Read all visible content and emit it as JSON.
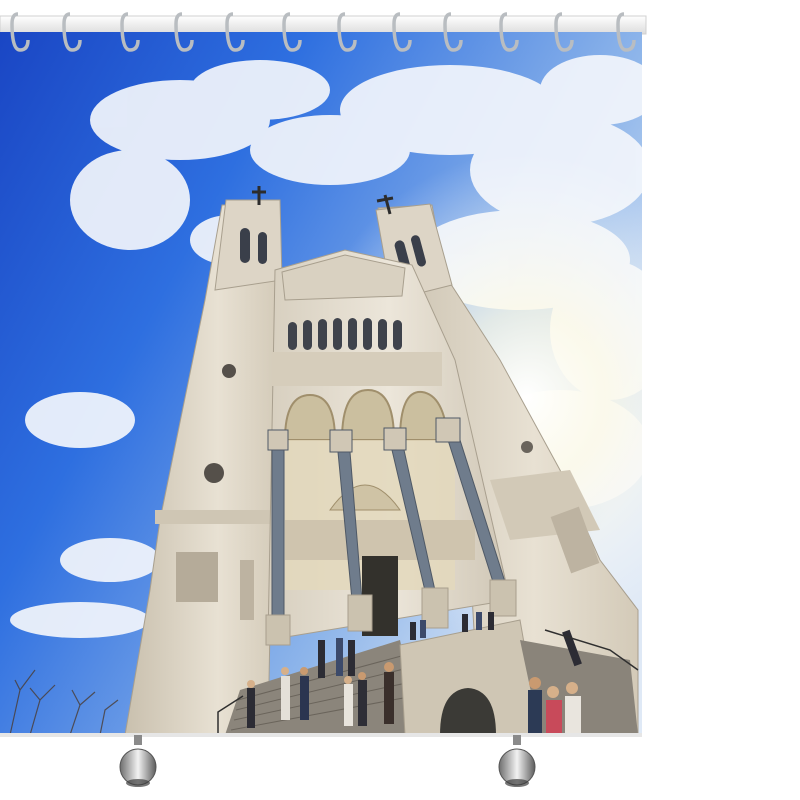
{
  "product": {
    "type": "shower curtain",
    "hook_count": 12,
    "weight_count": 2,
    "colors": {
      "background": "#ffffff",
      "rod": "#e9e9e9",
      "hook": "#bfc3c6",
      "sky_deep": "#1e4fc7",
      "sky_light": "#6fa6e8",
      "cloud": "#f4f6fb",
      "stone": "#e6dfd2",
      "stone_shadow": "#b9b0a0",
      "column": "#6f7c8c",
      "sun_flare": "#fff8d6"
    }
  },
  "photo": {
    "subject": "basilica facade",
    "feature_icons": [
      "cross-icon",
      "cross-icon"
    ]
  }
}
